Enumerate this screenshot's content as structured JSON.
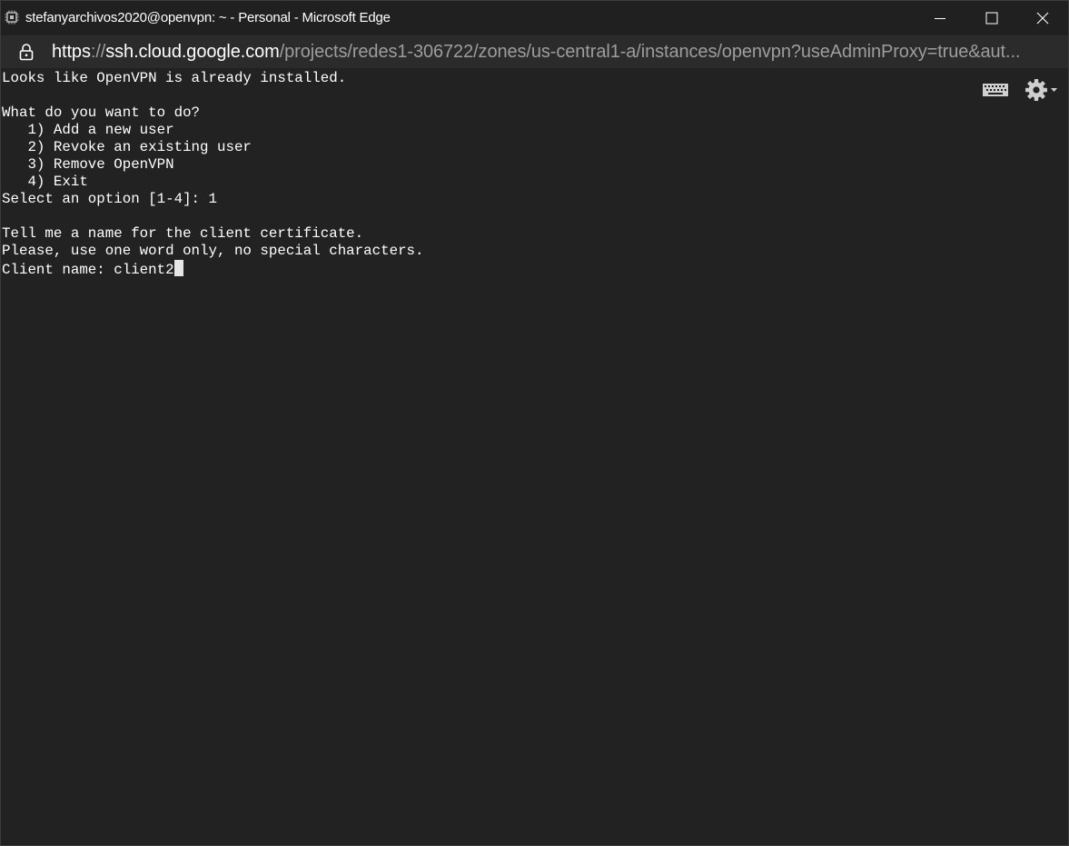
{
  "window": {
    "title": "stefanyarchivos2020@openvpn: ~ - Personal - Microsoft Edge",
    "controls": {
      "minimize": "minimize",
      "maximize": "maximize",
      "close": "close"
    }
  },
  "address_bar": {
    "scheme": "https",
    "separator": "://",
    "host": "ssh.cloud.google.com",
    "path": "/projects/redes1-306722/zones/us-central1-a/instances/openvpn?useAdminProxy=true&aut..."
  },
  "terminal": {
    "lines": [
      "Looks like OpenVPN is already installed.",
      "",
      "What do you want to do?",
      "   1) Add a new user",
      "   2) Revoke an existing user",
      "   3) Remove OpenVPN",
      "   4) Exit",
      "Select an option [1-4]: 1",
      "",
      "Tell me a name for the client certificate.",
      "Please, use one word only, no special characters."
    ],
    "prompt_line": "Client name: client2"
  },
  "toolbar": {
    "keyboard_icon": "keyboard-icon",
    "settings_icon": "gear-icon"
  },
  "colors": {
    "background": "#222222",
    "titlebar": "#202020",
    "addressbar": "#2b2b2b",
    "text": "#ffffff",
    "url_dim": "#9d9d9d"
  }
}
